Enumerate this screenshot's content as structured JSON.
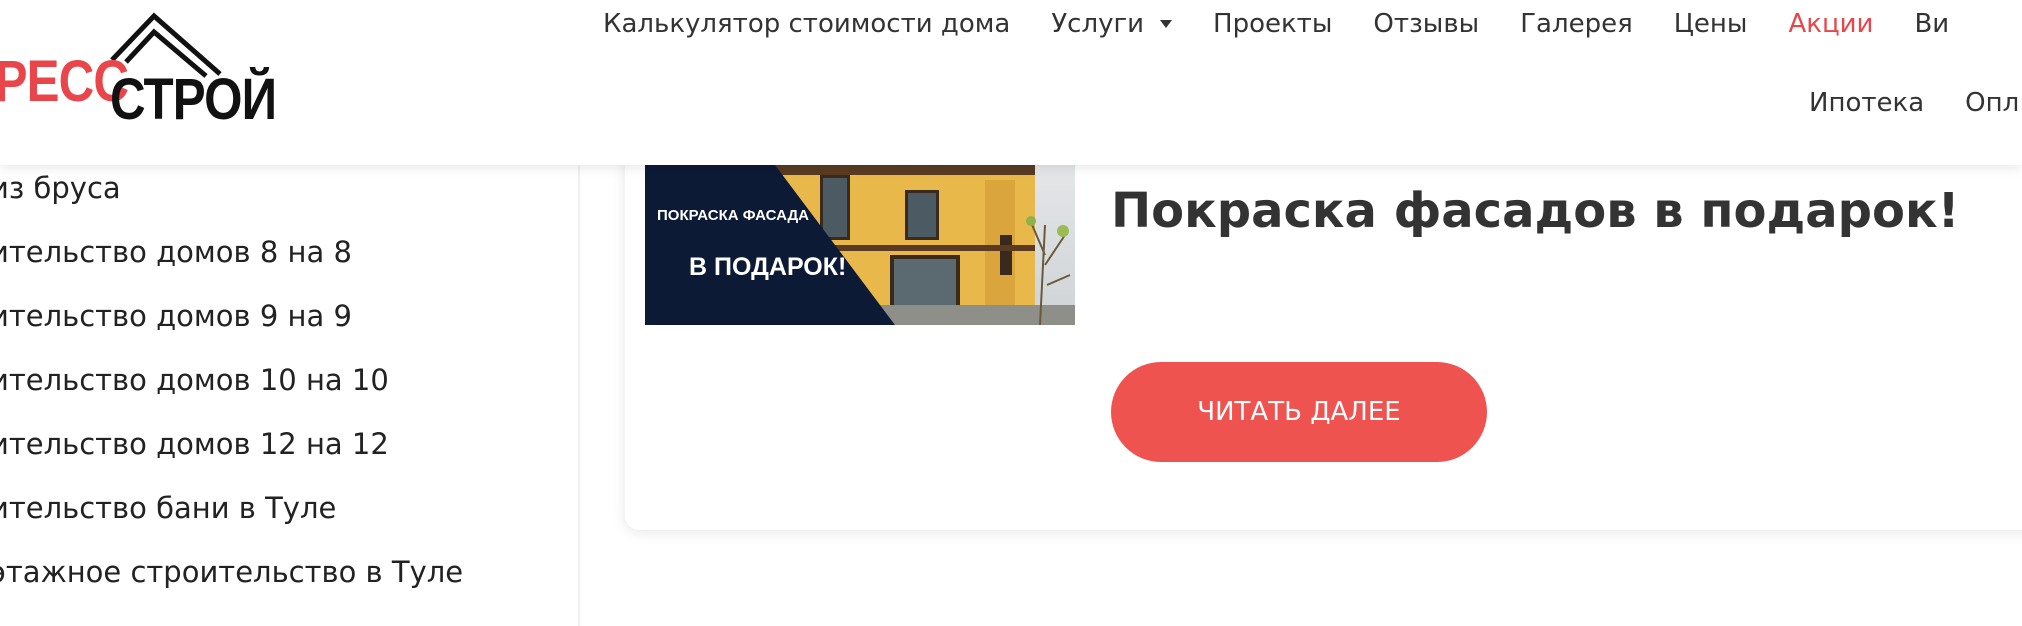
{
  "logo": {
    "part1": "ПРЕСС",
    "part2": "СТРОЙ"
  },
  "nav": {
    "row1": [
      {
        "label": "Калькулятор стоимости дома"
      },
      {
        "label": "Услуги",
        "has_caret": true
      },
      {
        "label": "Проекты"
      },
      {
        "label": "Отзывы"
      },
      {
        "label": "Галерея"
      },
      {
        "label": "Цены"
      },
      {
        "label": "Акции",
        "highlight": true
      },
      {
        "label": "Ви"
      }
    ],
    "row2": [
      {
        "label": "Ипотека"
      },
      {
        "label": "Опл"
      }
    ]
  },
  "sidebar": {
    "items": [
      "из бруса",
      "ительство домов 8 на 8",
      "ительство домов 9 на 9",
      "ительство домов 10 на 10",
      "ительство домов 12 на 12",
      "ительство бани в Туле",
      "этажное строительство в Туле"
    ]
  },
  "post": {
    "thumb_text1": "ПОКРАСКА ФАСАДА",
    "thumb_text2": "В ПОДАРОК!",
    "title": "Покраска фасадов в подарок!",
    "read_more": "ЧИТАТЬ ДАЛЕЕ"
  },
  "colors": {
    "accent": "#e8464a",
    "button": "#ef5350",
    "thumb_dark": "#0d1a36",
    "wall": "#e9b84a"
  }
}
